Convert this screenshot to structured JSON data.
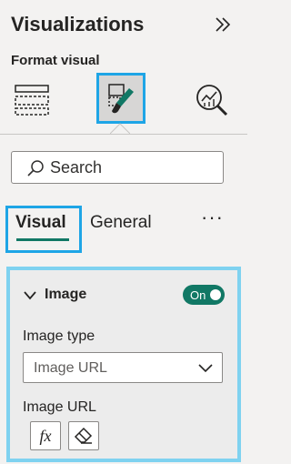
{
  "header": {
    "title": "Visualizations",
    "collapse_icon": "double-chevron-right-icon"
  },
  "subheader": {
    "label": "Format visual"
  },
  "pane_icons": [
    {
      "name": "build-visual",
      "icon": "build-visual-icon",
      "selected": false
    },
    {
      "name": "format-visual",
      "icon": "format-paintbrush-icon",
      "selected": true
    },
    {
      "name": "analytics",
      "icon": "analytics-magnifier-icon",
      "selected": false
    }
  ],
  "search": {
    "placeholder": "Search",
    "value": ""
  },
  "tabs": [
    {
      "label": "Visual",
      "active": true
    },
    {
      "label": "General",
      "active": false
    }
  ],
  "more_label": "···",
  "section": {
    "title": "Image",
    "expanded": true,
    "toggle": {
      "label": "On",
      "state": true
    },
    "fields": {
      "image_type_label": "Image type",
      "image_type_value": "Image URL",
      "image_url_label": "Image URL"
    },
    "buttons": {
      "fx_label": "fx"
    }
  },
  "colors": {
    "accent": "#117865",
    "highlight": "#1ea5e6",
    "panel_bg": "#f3f2f1"
  }
}
